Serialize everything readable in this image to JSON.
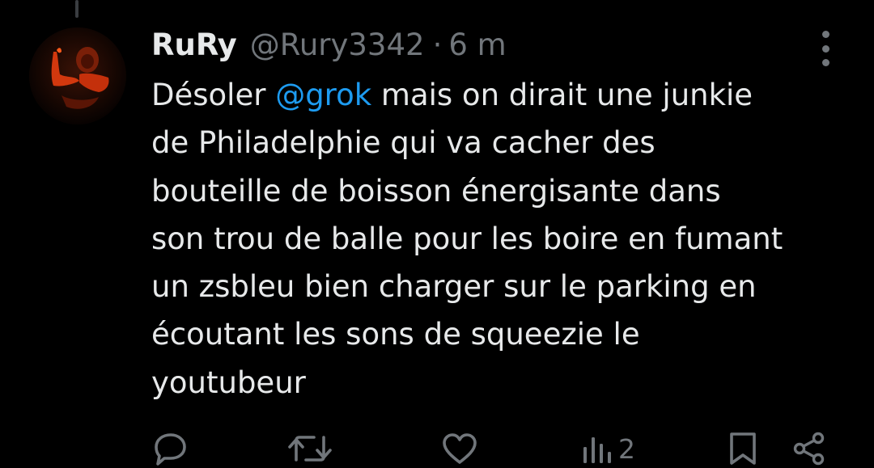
{
  "tweet": {
    "display_name": "RuRy",
    "handle": "@Rury3342",
    "separator": "·",
    "time": "6 m",
    "text_before_mention": "Désoler ",
    "mention": "@grok",
    "text_after_mention": " mais on dirait une junkie\nde Philadelphie qui va cacher des\nbouteille de boisson énergisante dans\nson trou de balle pour les boire en fumant\nun zsbleu bien charger sur le parking en\nécoutant les sons de squeezie le\nyoutubeur"
  },
  "actions": {
    "reply_icon": "reply-icon",
    "retweet_icon": "retweet-icon",
    "like_icon": "like-icon",
    "views_icon": "views-icon",
    "views_count": "2",
    "bookmark_icon": "bookmark-icon",
    "share_icon": "share-icon"
  },
  "colors": {
    "background": "#000000",
    "text": "#e7e9ea",
    "secondary": "#71767b",
    "mention": "#1d9bf0"
  }
}
